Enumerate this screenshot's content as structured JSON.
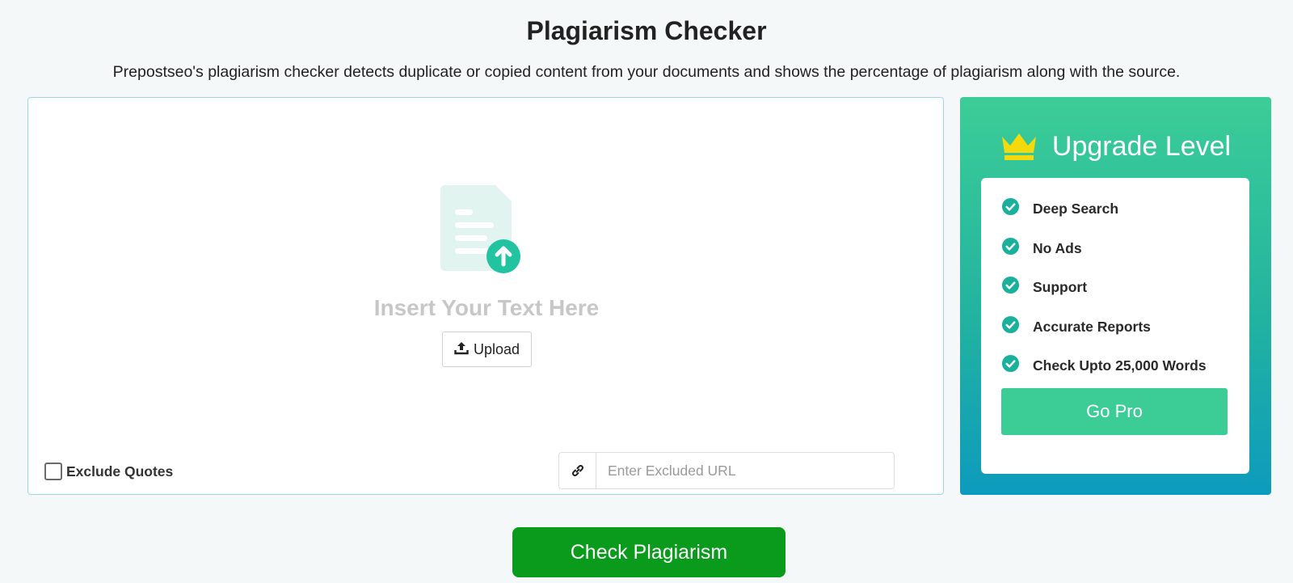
{
  "header": {
    "title": "Plagiarism Checker",
    "subtitle": "Prepostseo's plagiarism checker detects duplicate or copied content from your documents and shows the percentage of plagiarism along with the source."
  },
  "editor": {
    "placeholder_heading": "Insert Your Text Here",
    "upload_label": "Upload",
    "upload_icon": "upload-icon",
    "illustration_icon": "document-upload-icon",
    "exclude_quotes_label": "Exclude Quotes",
    "exclude_quotes_checked": false,
    "excluded_url": {
      "icon": "link-icon",
      "value": "",
      "placeholder": "Enter Excluded URL"
    }
  },
  "upgrade": {
    "title": "Upgrade Level",
    "icon": "crown-icon",
    "features": [
      {
        "label": "Deep Search"
      },
      {
        "label": "No Ads"
      },
      {
        "label": "Support"
      },
      {
        "label": "Accurate Reports"
      },
      {
        "label": "Check Upto 25,000 Words"
      }
    ],
    "cta_label": "Go Pro"
  },
  "actions": {
    "check_label": "Check Plagiarism"
  },
  "colors": {
    "accent_green": "#3ccd97",
    "check_button": "#0a9a1c",
    "panel_gradient_end": "#0d9bbd",
    "crown": "#f5d90a"
  }
}
